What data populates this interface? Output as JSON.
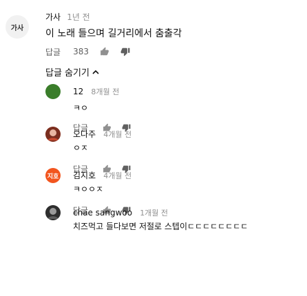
{
  "comment": {
    "avatar_text": "가사",
    "author": "가사",
    "time": "1년 전",
    "text": "이 노래 들으며 길거리에서 춤출각",
    "reply_label": "답글",
    "like_count": "383"
  },
  "replies_toggle": {
    "label": "답글 숨기기"
  },
  "replies": [
    {
      "avatar_color": "#3a7d2a",
      "avatar_text": "",
      "author": "12",
      "time": "8개월 전",
      "text": "ㅋㅇ",
      "reply_label": "답글"
    },
    {
      "avatar_color": "#c54a2f",
      "avatar_text": "",
      "author": "오다주",
      "time": "4개월 전",
      "text": "ㅇㅈ",
      "reply_label": "답글"
    },
    {
      "avatar_color": "#f2551e",
      "avatar_text": "지호",
      "author": "김지호",
      "time": "4개월 전",
      "text": "ㅋㅇㅇㅈ",
      "reply_label": "답글"
    },
    {
      "avatar_color": "#4a4a4a",
      "avatar_text": "",
      "author": "chae sangwoo",
      "time": "1개월 전",
      "text": "치즈먹고 들다보면 저절로 스텝이ㄷㄷㄷㄷㄷㄷㄷㄷ",
      "reply_label": ""
    }
  ]
}
